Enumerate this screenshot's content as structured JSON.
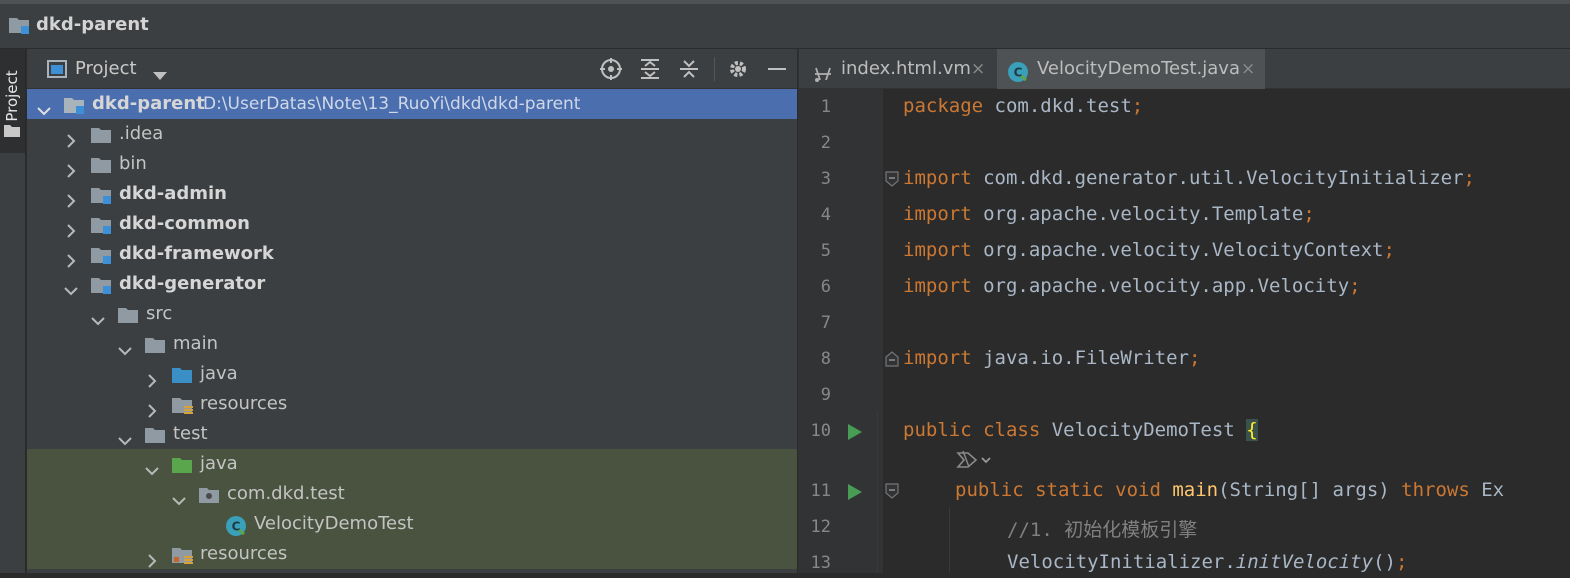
{
  "navbar": {
    "title": "dkd-parent"
  },
  "toolstrip": {
    "project_label": "Project"
  },
  "project_panel": {
    "header_label": "Project",
    "tree": [
      {
        "label": "dkd-parent",
        "path": "D:\\UserDatas\\Note\\13_RuoYi\\dkd\\dkd-parent"
      },
      {
        "label": ".idea"
      },
      {
        "label": "bin"
      },
      {
        "label": "dkd-admin"
      },
      {
        "label": "dkd-common"
      },
      {
        "label": "dkd-framework"
      },
      {
        "label": "dkd-generator"
      },
      {
        "label": "src"
      },
      {
        "label": "main"
      },
      {
        "label": "java"
      },
      {
        "label": "resources"
      },
      {
        "label": "test"
      },
      {
        "label": "java"
      },
      {
        "label": "com.dkd.test"
      },
      {
        "label": "VelocityDemoTest"
      },
      {
        "label": "resources"
      }
    ]
  },
  "editor": {
    "tabs": [
      {
        "label": "index.html.vm",
        "close": "×"
      },
      {
        "label": "VelocityDemoTest.java",
        "close": "×"
      }
    ],
    "line_numbers": [
      "1",
      "2",
      "3",
      "4",
      "5",
      "6",
      "7",
      "8",
      "9",
      "10",
      "11",
      "12",
      "13"
    ],
    "code": {
      "l1": {
        "kw": "package",
        "rest": " com.dkd.test",
        "semi": ";"
      },
      "l3": {
        "kw": "import",
        "rest": " com.dkd.generator.util.VelocityInitializer",
        "semi": ";"
      },
      "l4": {
        "kw": "import",
        "rest": " org.apache.velocity.Template",
        "semi": ";"
      },
      "l5": {
        "kw": "import",
        "rest": " org.apache.velocity.VelocityContext",
        "semi": ";"
      },
      "l6": {
        "kw": "import",
        "rest": " org.apache.velocity.app.Velocity",
        "semi": ";"
      },
      "l8": {
        "kw": "import",
        "rest": " java.io.FileWriter",
        "semi": ";"
      },
      "l10": {
        "kw": "public class",
        "rest": " VelocityDemoTest ",
        "brace": "{"
      },
      "l11": {
        "kw": "public static void",
        "fn": " main",
        "rest": "(String[] args) ",
        "kw2": "throws",
        "rest2": " Ex"
      },
      "l12": {
        "comment": "//1. 初始化模板引擎"
      },
      "l13": {
        "obj": "VelocityInitializer.",
        "call": "initVelocity",
        "rest": "()",
        "semi": ";"
      }
    }
  },
  "colors": {
    "selected_row": "#4b6eaf",
    "test_source_row": "#49533f",
    "keyword": "#cc7832",
    "method": "#ffc66d",
    "run_gutter": "#499c54"
  }
}
